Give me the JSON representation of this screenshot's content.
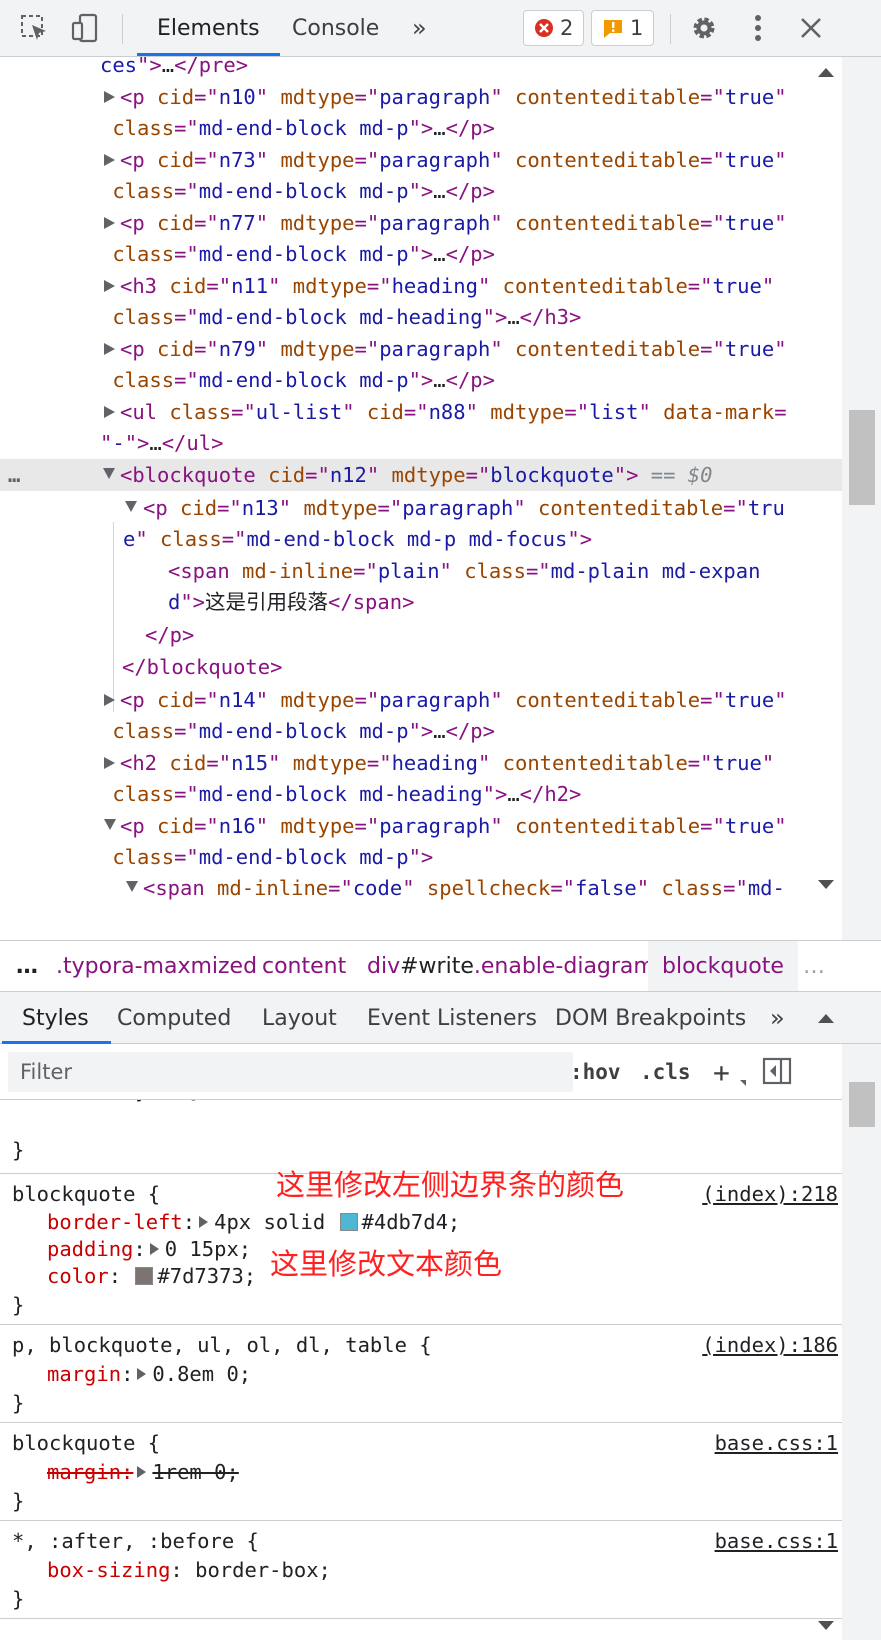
{
  "toolbar": {
    "tabs": [
      {
        "label": "Elements",
        "active": true
      },
      {
        "label": "Console",
        "active": false
      }
    ],
    "more_tabs_label": "»",
    "errors": {
      "count": "2",
      "icon": "error-circle-icon",
      "color": "#d93025"
    },
    "warnings": {
      "count": "1",
      "icon": "warning-flag-icon",
      "color": "#f29900"
    }
  },
  "dom_tree": {
    "lines": [
      [
        "ces",
        "\">…</pre>"
      ],
      [
        "<p cid=\"n10\" mdtype=\"paragraph\" contenteditable=\"true\"",
        "class=\"md-end-block md-p\">…</p>"
      ],
      [
        "<p cid=\"n73\" mdtype=\"paragraph\" contenteditable=\"true\"",
        "class=\"md-end-block md-p\">…</p>"
      ],
      [
        "<p cid=\"n77\" mdtype=\"paragraph\" contenteditable=\"true\"",
        "class=\"md-end-block md-p\">…</p>"
      ],
      [
        "<h3 cid=\"n11\" mdtype=\"heading\" contenteditable=\"true\"",
        "class=\"md-end-block md-heading\">…</h3>"
      ],
      [
        "<p cid=\"n79\" mdtype=\"paragraph\" contenteditable=\"true\"",
        "class=\"md-end-block md-p\">…</p>"
      ],
      [
        "<ul class=\"ul-list\" cid=\"n88\" mdtype=\"list\" data-mark=",
        "\"-\">…</ul>"
      ]
    ],
    "selected_line": "<blockquote cid=\"n12\" mdtype=\"blockquote\">",
    "selected_marker": "== $0",
    "row_dots": "…",
    "p_open_1": "<p cid=\"n13\" mdtype=\"paragraph\" contenteditable=\"tru",
    "p_open_2": "e\" class=\"md-end-block md-p md-focus\">",
    "span_1": "<span md-inline=\"plain\" class=\"md-plain md-expan",
    "span_2a": "d\">",
    "span_text": "这是引用段落",
    "span_2b": "</span>",
    "p_close": "</p>",
    "bq_close": "</blockquote>",
    "after_lines": [
      [
        "<p cid=\"n14\" mdtype=\"paragraph\" contenteditable=\"true\"",
        "class=\"md-end-block md-p\">…</p>"
      ],
      [
        "<h2 cid=\"n15\" mdtype=\"heading\" contenteditable=\"true\"",
        "class=\"md-end-block md-heading\">…</h2>"
      ],
      [
        "<p cid=\"n16\" mdtype=\"paragraph\" contenteditable=\"true\"",
        "class=\"md-end-block md-p\">"
      ]
    ],
    "last_line": "<span md-inline=\"code\" spellcheck=\"false\" class=\"md-"
  },
  "breadcrumb": {
    "lead": "…",
    "items": [
      ".typora-maxmized",
      "content",
      "div#write.enable-diagrams",
      "blockquote"
    ],
    "trail": "…"
  },
  "styles_tabs": {
    "tabs": [
      "Styles",
      "Computed",
      "Layout",
      "Event Listeners",
      "DOM Breakpoints"
    ],
    "active": "Styles",
    "more_label": "»"
  },
  "filter": {
    "placeholder": "Filter",
    "hov": ":hov",
    "cls": ".cls",
    "add": "+"
  },
  "rules": {
    "element_style": {
      "selector": "element.style {",
      "close": "}"
    },
    "blockquote1": {
      "selector": "blockquote {",
      "source": "(index):218",
      "props": [
        {
          "name": "border-left",
          "value": "4px solid ",
          "color": "#4db7d4",
          "color_text": "#4db7d4;"
        },
        {
          "name": "padding",
          "value": "0 15px;"
        },
        {
          "name": "color",
          "value": "",
          "color": "#7d7373",
          "color_text": "#7d7373;"
        }
      ],
      "close": "}"
    },
    "note1": "这里修改左侧边界条的颜色",
    "note2": "这里修改文本颜色",
    "shared": {
      "selector": "p, blockquote, ul, ol, dl, table {",
      "source": "(index):186",
      "prop_name": "margin",
      "prop_value": "0.8em 0;",
      "close": "}"
    },
    "blockquote2": {
      "selector": "blockquote {",
      "source": "base.css:1",
      "prop_name": "margin",
      "prop_value": "1rem 0;",
      "close": "}"
    },
    "universal": {
      "selector": "*, :after, :before {",
      "source": "base.css:1",
      "prop_name": "box-sizing",
      "prop_value": "border-box;",
      "close": "}"
    }
  }
}
